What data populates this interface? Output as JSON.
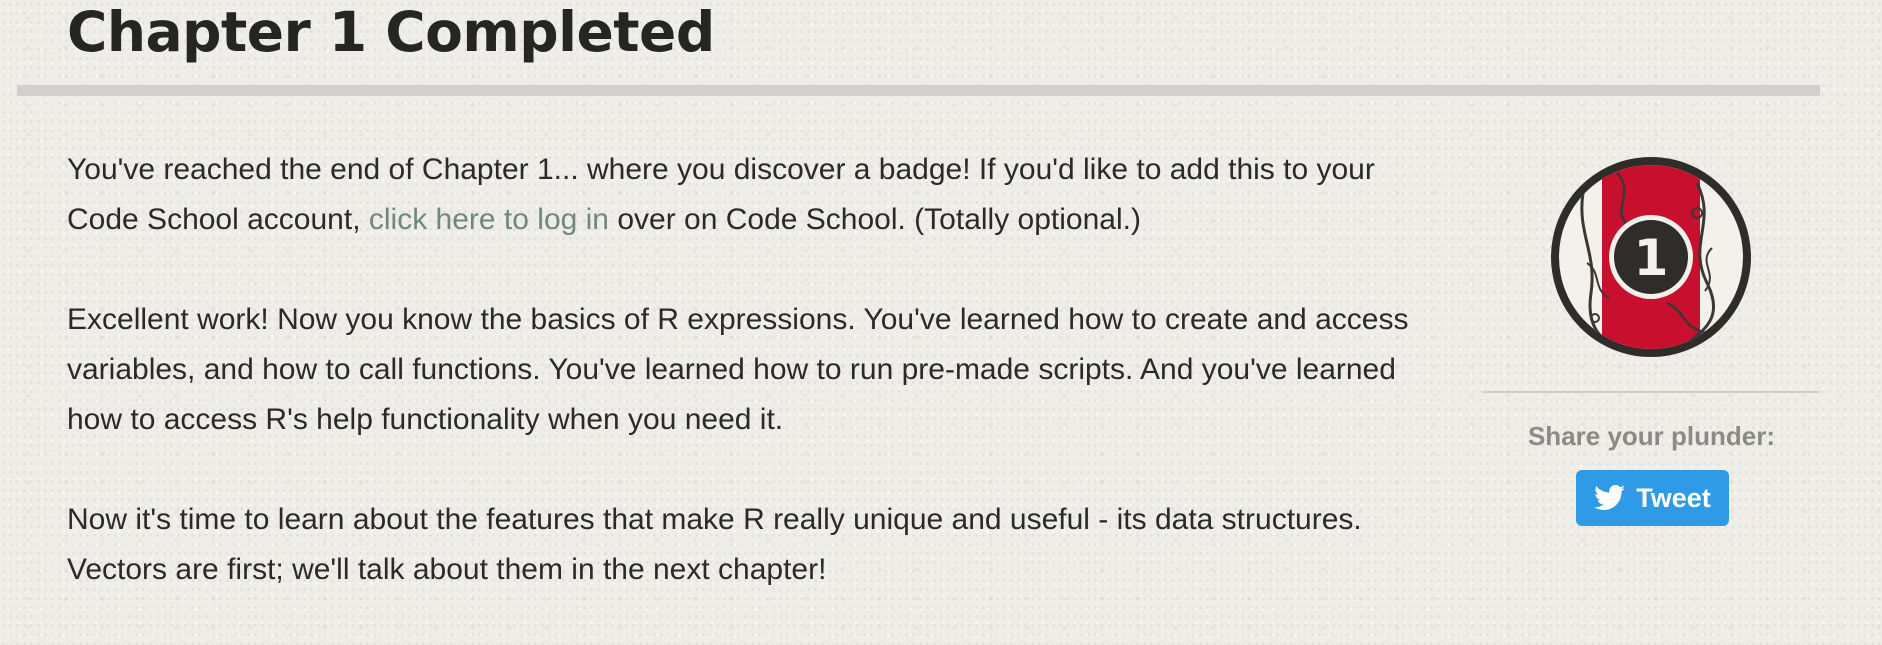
{
  "page": {
    "title": "Chapter 1 Completed"
  },
  "content": {
    "p1_before_link": "You've reached the end of Chapter 1... where you discover a badge! If you'd like to add this to your Code School account, ",
    "p1_link": "click here to log in",
    "p1_after_link": " over on Code School. (Totally optional.)",
    "p2": "Excellent work! Now you know the basics of R expressions. You've learned how to create and access variables, and how to call functions. You've learned how to run pre-made scripts. And you've learned how to access R's help functionality when you need it.",
    "p3": "Now it's time to learn about the features that make R really unique and useful - its data structures. Vectors are first; we'll talk about them in the next chapter!"
  },
  "sidebar": {
    "badge_number": "1",
    "share_label": "Share your plunder:",
    "tweet_label": "Tweet",
    "tweet_icon": "twitter-bird-icon"
  },
  "colors": {
    "link": "#6f887f",
    "badge_red": "#c8102e",
    "badge_dark": "#2f2d2a",
    "tweet_blue": "#2f9be6",
    "rule": "#d1d0cc"
  }
}
